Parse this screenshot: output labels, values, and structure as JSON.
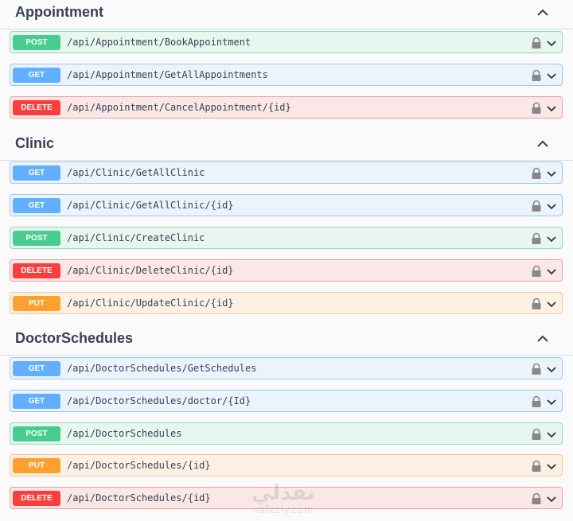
{
  "sections": [
    {
      "title": "Appointment",
      "operations": [
        {
          "method": "POST",
          "path": "/api/Appointment/BookAppointment"
        },
        {
          "method": "GET",
          "path": "/api/Appointment/GetAllAppointments"
        },
        {
          "method": "DELETE",
          "path": "/api/Appointment/CancelAppointment/{id}"
        }
      ]
    },
    {
      "title": "Clinic",
      "operations": [
        {
          "method": "GET",
          "path": "/api/Clinic/GetAllClinic"
        },
        {
          "method": "GET",
          "path": "/api/Clinic/GetAllClinic/{id}"
        },
        {
          "method": "POST",
          "path": "/api/Clinic/CreateClinic"
        },
        {
          "method": "DELETE",
          "path": "/api/Clinic/DeleteClinic/{id}"
        },
        {
          "method": "PUT",
          "path": "/api/Clinic/UpdateClinic/{id}"
        }
      ]
    },
    {
      "title": "DoctorSchedules",
      "operations": [
        {
          "method": "GET",
          "path": "/api/DoctorSchedules/GetSchedules"
        },
        {
          "method": "GET",
          "path": "/api/DoctorSchedules/doctor/{Id}"
        },
        {
          "method": "POST",
          "path": "/api/DoctorSchedules"
        },
        {
          "method": "PUT",
          "path": "/api/DoctorSchedules/{id}"
        },
        {
          "method": "DELETE",
          "path": "/api/DoctorSchedules/{id}"
        }
      ]
    }
  ],
  "icons": {
    "section_toggle": "chevron-up-icon",
    "auth": "lock-icon",
    "expand": "chevron-down-icon"
  },
  "colors": {
    "POST": "#49cc90",
    "GET": "#61affe",
    "DELETE": "#f93e3e",
    "PUT": "#fca130"
  },
  "watermark": {
    "arabic": "نفذلي",
    "latin": "nafezly.com"
  }
}
